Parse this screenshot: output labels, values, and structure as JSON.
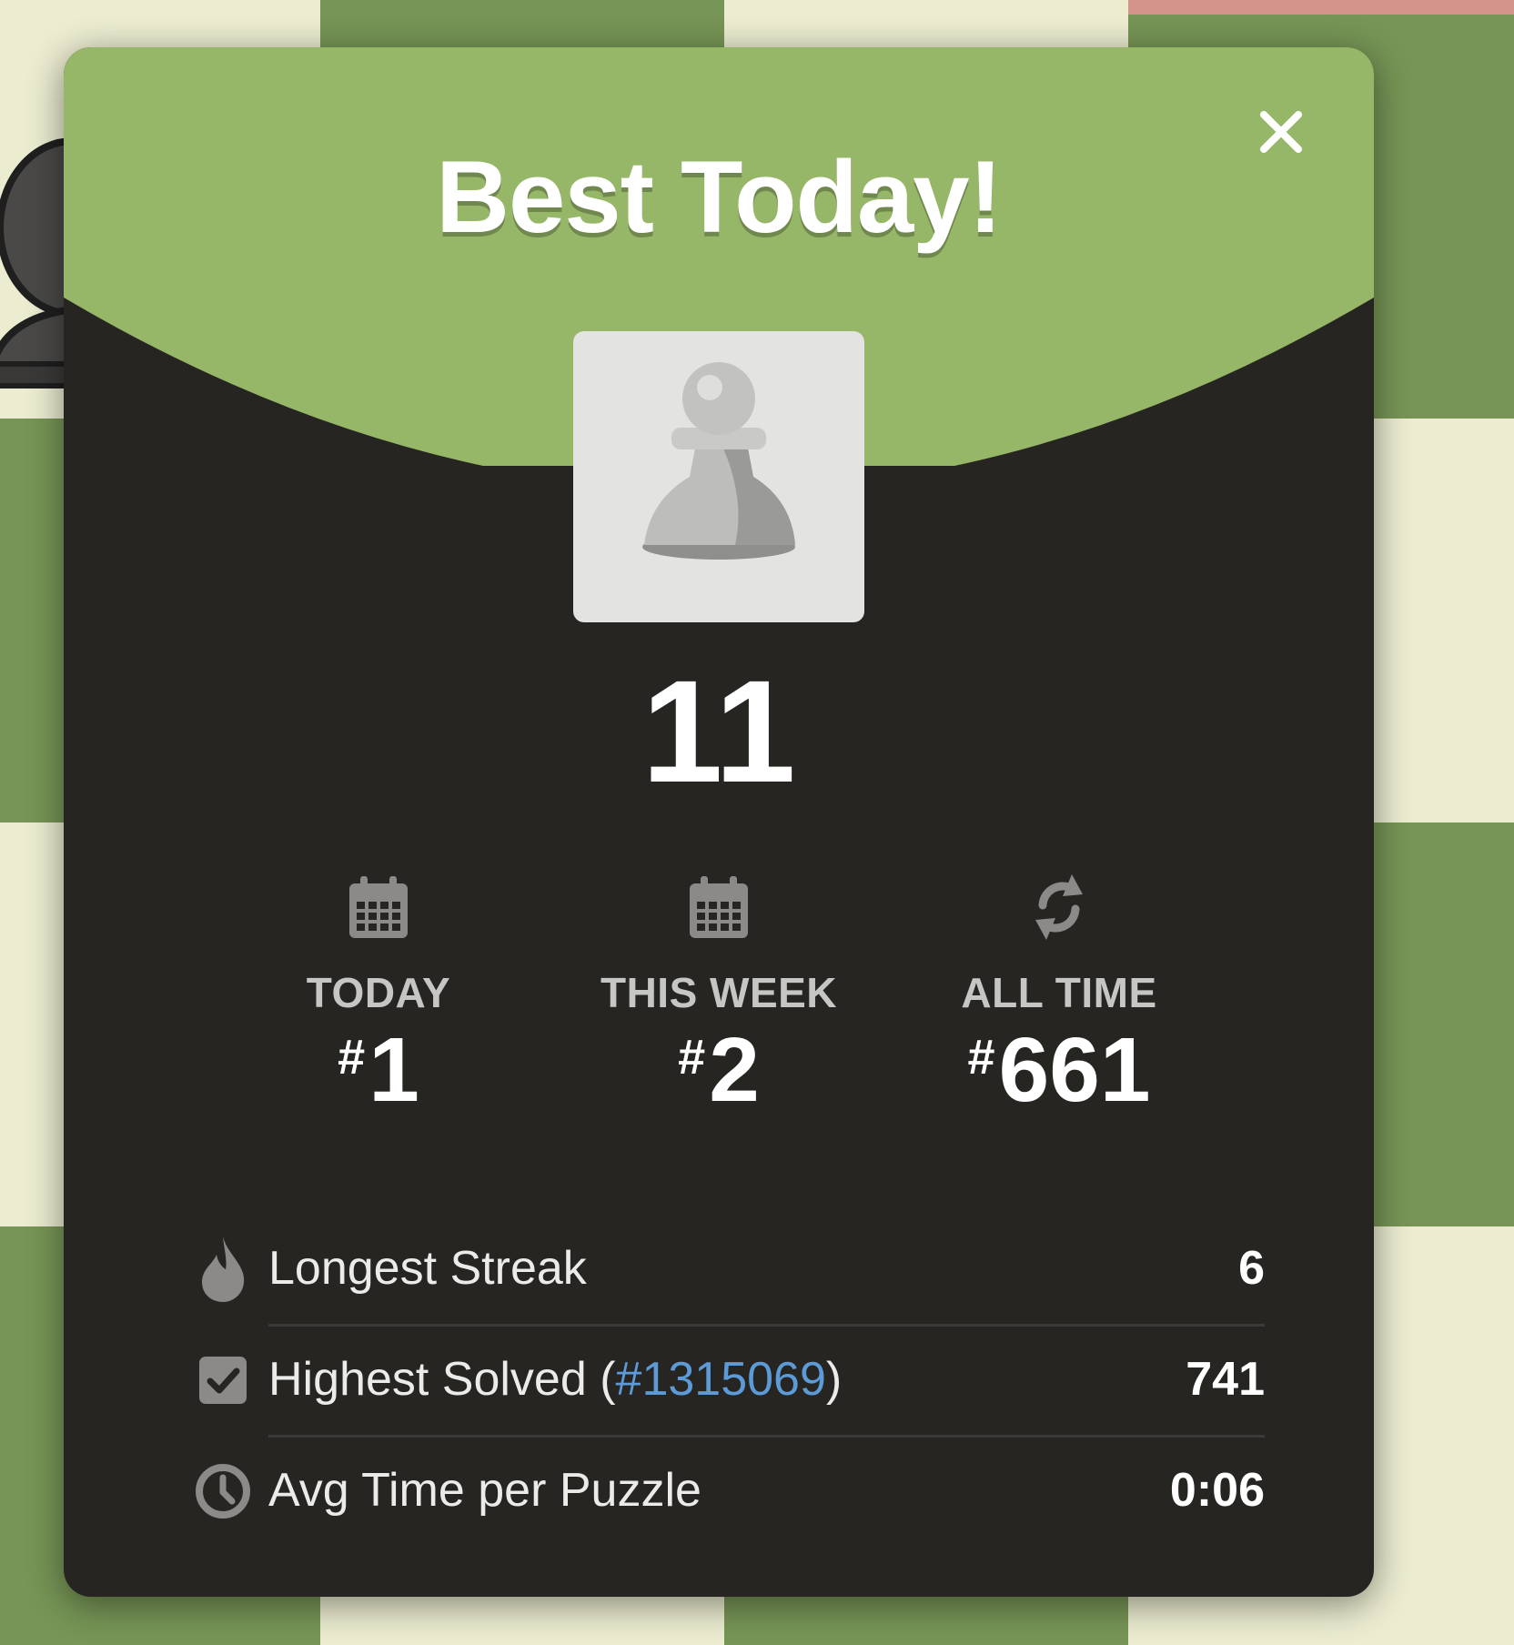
{
  "modal": {
    "title": "Best Today!",
    "score": "11",
    "close_icon": "close-icon",
    "piece_icon": "white-pawn-icon"
  },
  "ranks": [
    {
      "icon": "calendar-icon",
      "label": "TODAY",
      "hash": "#",
      "value": "1"
    },
    {
      "icon": "calendar-icon",
      "label": "THIS WEEK",
      "hash": "#",
      "value": "2"
    },
    {
      "icon": "refresh-icon",
      "label": "ALL TIME",
      "hash": "#",
      "value": "661"
    }
  ],
  "stats": [
    {
      "icon": "flame-icon",
      "label": "Longest Streak",
      "value": "6"
    },
    {
      "icon": "checkbox-icon",
      "label_prefix": "Highest Solved (",
      "link": "#1315069",
      "label_suffix": ")",
      "value": "741"
    },
    {
      "icon": "clock-icon",
      "label": "Avg Time per Puzzle",
      "value": "0:06"
    }
  ],
  "colors": {
    "board_light": "#ebecd0",
    "board_dark": "#779556",
    "header_green": "#96b668",
    "modal_bg": "#262522",
    "link_blue": "#5d9bd8"
  }
}
